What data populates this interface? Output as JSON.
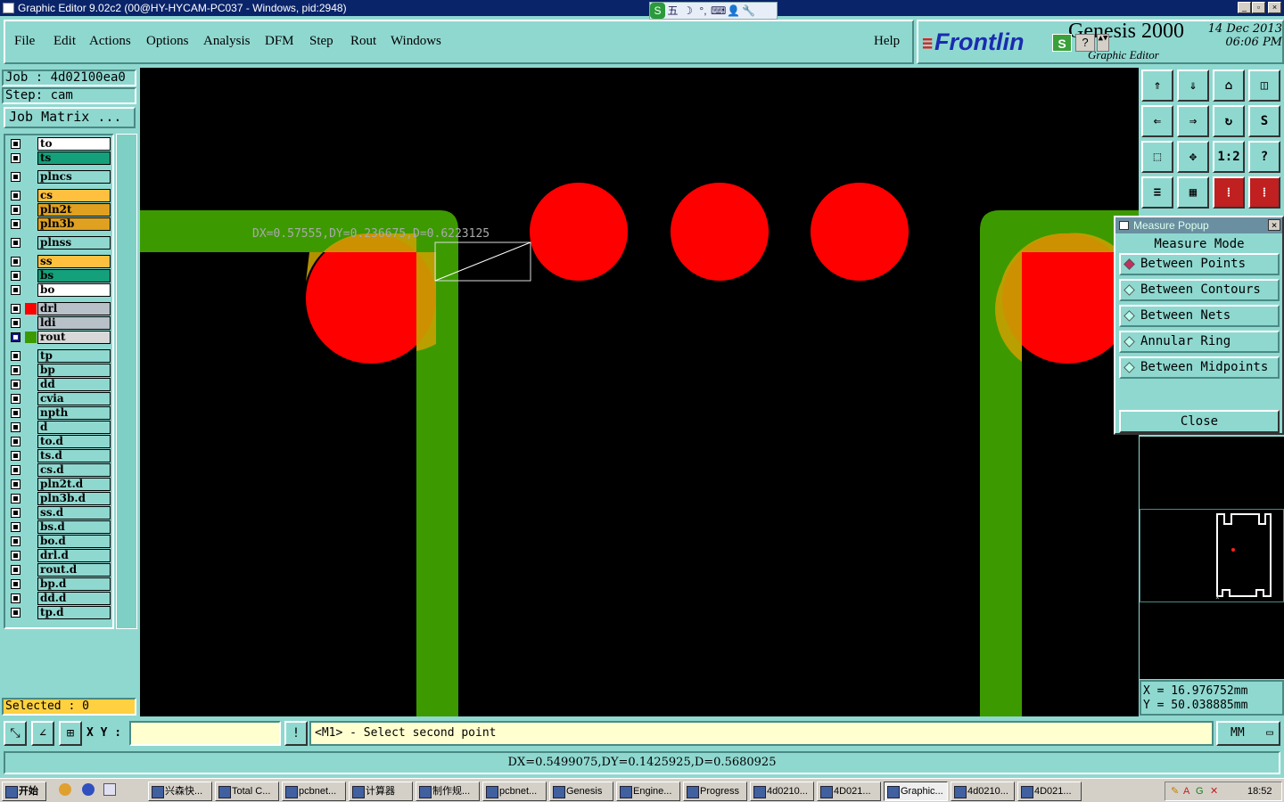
{
  "window": {
    "title": "Graphic Editor 9.02c2 (00@HY-HYCAM-PC037 - Windows, pid:2948)",
    "min_label": "_",
    "max_label": "▫",
    "close_label": "×"
  },
  "ime_bar": [
    "S",
    "五",
    "☽",
    "°,",
    "⌨",
    "👤",
    "🔧"
  ],
  "menu": {
    "items": [
      "File",
      "Edit",
      "Actions",
      "Options",
      "Analysis",
      "DFM",
      "Step",
      "Rout",
      "Windows"
    ],
    "help": "Help"
  },
  "brand": {
    "logo": "Frontlin",
    "product": "Genesis 2000",
    "subtitle": "Graphic Editor",
    "date": "14 Dec 2013",
    "time": "06:06 PM",
    "s_label": "S",
    "q_label": "?",
    "arrows": "▲▼"
  },
  "job": {
    "label": "Job  : 4d02100ea0",
    "step": "Step: cam",
    "matrix_button": "Job Matrix ..."
  },
  "layers": [
    {
      "name": "to",
      "color": "#ffffff",
      "group": 0
    },
    {
      "name": "ts",
      "color": "#14a07a",
      "group": 0
    },
    {
      "name": "plncs",
      "color": "#8fd8d0",
      "group": 1
    },
    {
      "name": "cs",
      "color": "#ffc040",
      "group": 2
    },
    {
      "name": "pln2t",
      "color": "#e0a020",
      "group": 2
    },
    {
      "name": "pln3b",
      "color": "#e0a020",
      "group": 2
    },
    {
      "name": "plnss",
      "color": "#8fd8d0",
      "group": 3
    },
    {
      "name": "ss",
      "color": "#ffc040",
      "group": 4
    },
    {
      "name": "bs",
      "color": "#14a07a",
      "group": 4
    },
    {
      "name": "bo",
      "color": "#ffffff",
      "group": 4
    },
    {
      "name": "drl",
      "color": "#b8c0c8",
      "swatch": "#ff0000",
      "group": 5
    },
    {
      "name": "ldi",
      "color": "#b8c0c8",
      "group": 5
    },
    {
      "name": "rout",
      "color": "#d8d8d8",
      "swatch": "#3c9a00",
      "active": true,
      "group": 5
    },
    {
      "name": "tp",
      "color": "#8fd8d0",
      "group": 6
    },
    {
      "name": "bp",
      "color": "#8fd8d0",
      "group": 6
    },
    {
      "name": "dd",
      "color": "#8fd8d0",
      "group": 6
    },
    {
      "name": "cvia",
      "color": "#8fd8d0",
      "group": 6
    },
    {
      "name": "npth",
      "color": "#8fd8d0",
      "group": 6
    },
    {
      "name": "d",
      "color": "#8fd8d0",
      "group": 6
    },
    {
      "name": "to.d",
      "color": "#8fd8d0",
      "group": 6
    },
    {
      "name": "ts.d",
      "color": "#8fd8d0",
      "group": 6
    },
    {
      "name": "cs.d",
      "color": "#8fd8d0",
      "group": 6
    },
    {
      "name": "pln2t.d",
      "color": "#8fd8d0",
      "group": 6
    },
    {
      "name": "pln3b.d",
      "color": "#8fd8d0",
      "group": 6
    },
    {
      "name": "ss.d",
      "color": "#8fd8d0",
      "group": 6
    },
    {
      "name": "bs.d",
      "color": "#8fd8d0",
      "group": 6
    },
    {
      "name": "bo.d",
      "color": "#8fd8d0",
      "group": 6
    },
    {
      "name": "drl.d",
      "color": "#8fd8d0",
      "group": 6
    },
    {
      "name": "rout.d",
      "color": "#8fd8d0",
      "group": 6
    },
    {
      "name": "bp.d",
      "color": "#8fd8d0",
      "group": 6
    },
    {
      "name": "dd.d",
      "color": "#8fd8d0",
      "group": 6
    },
    {
      "name": "tp.d",
      "color": "#8fd8d0",
      "group": 6
    }
  ],
  "selected": "Selected : 0",
  "canvas": {
    "measure_label": "DX=0.57555,DY=0.236675,D=0.6223125",
    "rout_color": "#3c9a00",
    "drill_color": "#ff0000",
    "overlap_color": "#c8a000"
  },
  "tool_icons": [
    "zoom-home-icon",
    "zoom-down-icon",
    "home-icon",
    "window-split-icon",
    "pan-left-icon",
    "pan-right-icon",
    "redraw-icon",
    "snap-icon",
    "fit-icon",
    "center-icon",
    "ratio-icon",
    "help-icon",
    "settings-icon",
    "grid-icon",
    "layer-red-icon",
    "layer-red2-icon"
  ],
  "tool_labels": [
    "⇑",
    "⇓",
    "⌂",
    "◫",
    "⇐",
    "⇒",
    "↻",
    "S",
    "⬚",
    "✥",
    "1:2",
    "?",
    "≡",
    "▦",
    "⁞",
    "⁞"
  ],
  "measure_popup": {
    "title": "Measure Popup",
    "mode_label": "Measure Mode",
    "options": [
      "Between Points",
      "Between Contours",
      "Between Nets",
      "Annular Ring",
      "Between Midpoints"
    ],
    "selected_index": 0,
    "close": "Close",
    "x_label": "×"
  },
  "coords": {
    "x": "X = 16.976752mm",
    "y": "Y = 50.038885mm"
  },
  "bottom": {
    "xy_label": "X Y :",
    "xy_value": "",
    "excl": "!",
    "message": "<M1> - Select second point",
    "units": "MM"
  },
  "status": "DX=0.5499075,DY=0.1425925,D=0.5680925",
  "taskbar": {
    "start": "开始",
    "tasks": [
      "兴森快...",
      "Total C...",
      "pcbnet...",
      "计算器",
      "制作规...",
      "pcbnet...",
      "Genesis",
      "Engine...",
      "Progress",
      "4d0210...",
      "4D021...",
      "Graphic...",
      "4d0210...",
      "4D021..."
    ],
    "active_index": 11,
    "clock": "18:52"
  }
}
